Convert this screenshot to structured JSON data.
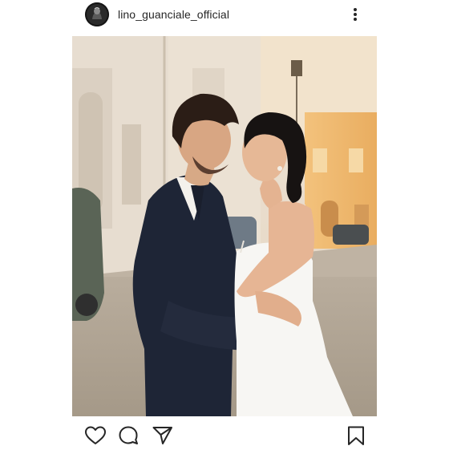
{
  "post": {
    "username": "lino_guanciale_official",
    "icons": {
      "avatar": "profile-avatar",
      "more": "more-vertical-icon",
      "like": "heart-icon",
      "comment": "comment-bubble-icon",
      "share": "paper-plane-icon",
      "save": "bookmark-icon"
    },
    "colors": {
      "text": "#262626",
      "icon": "#262626",
      "background": "#ffffff"
    }
  }
}
